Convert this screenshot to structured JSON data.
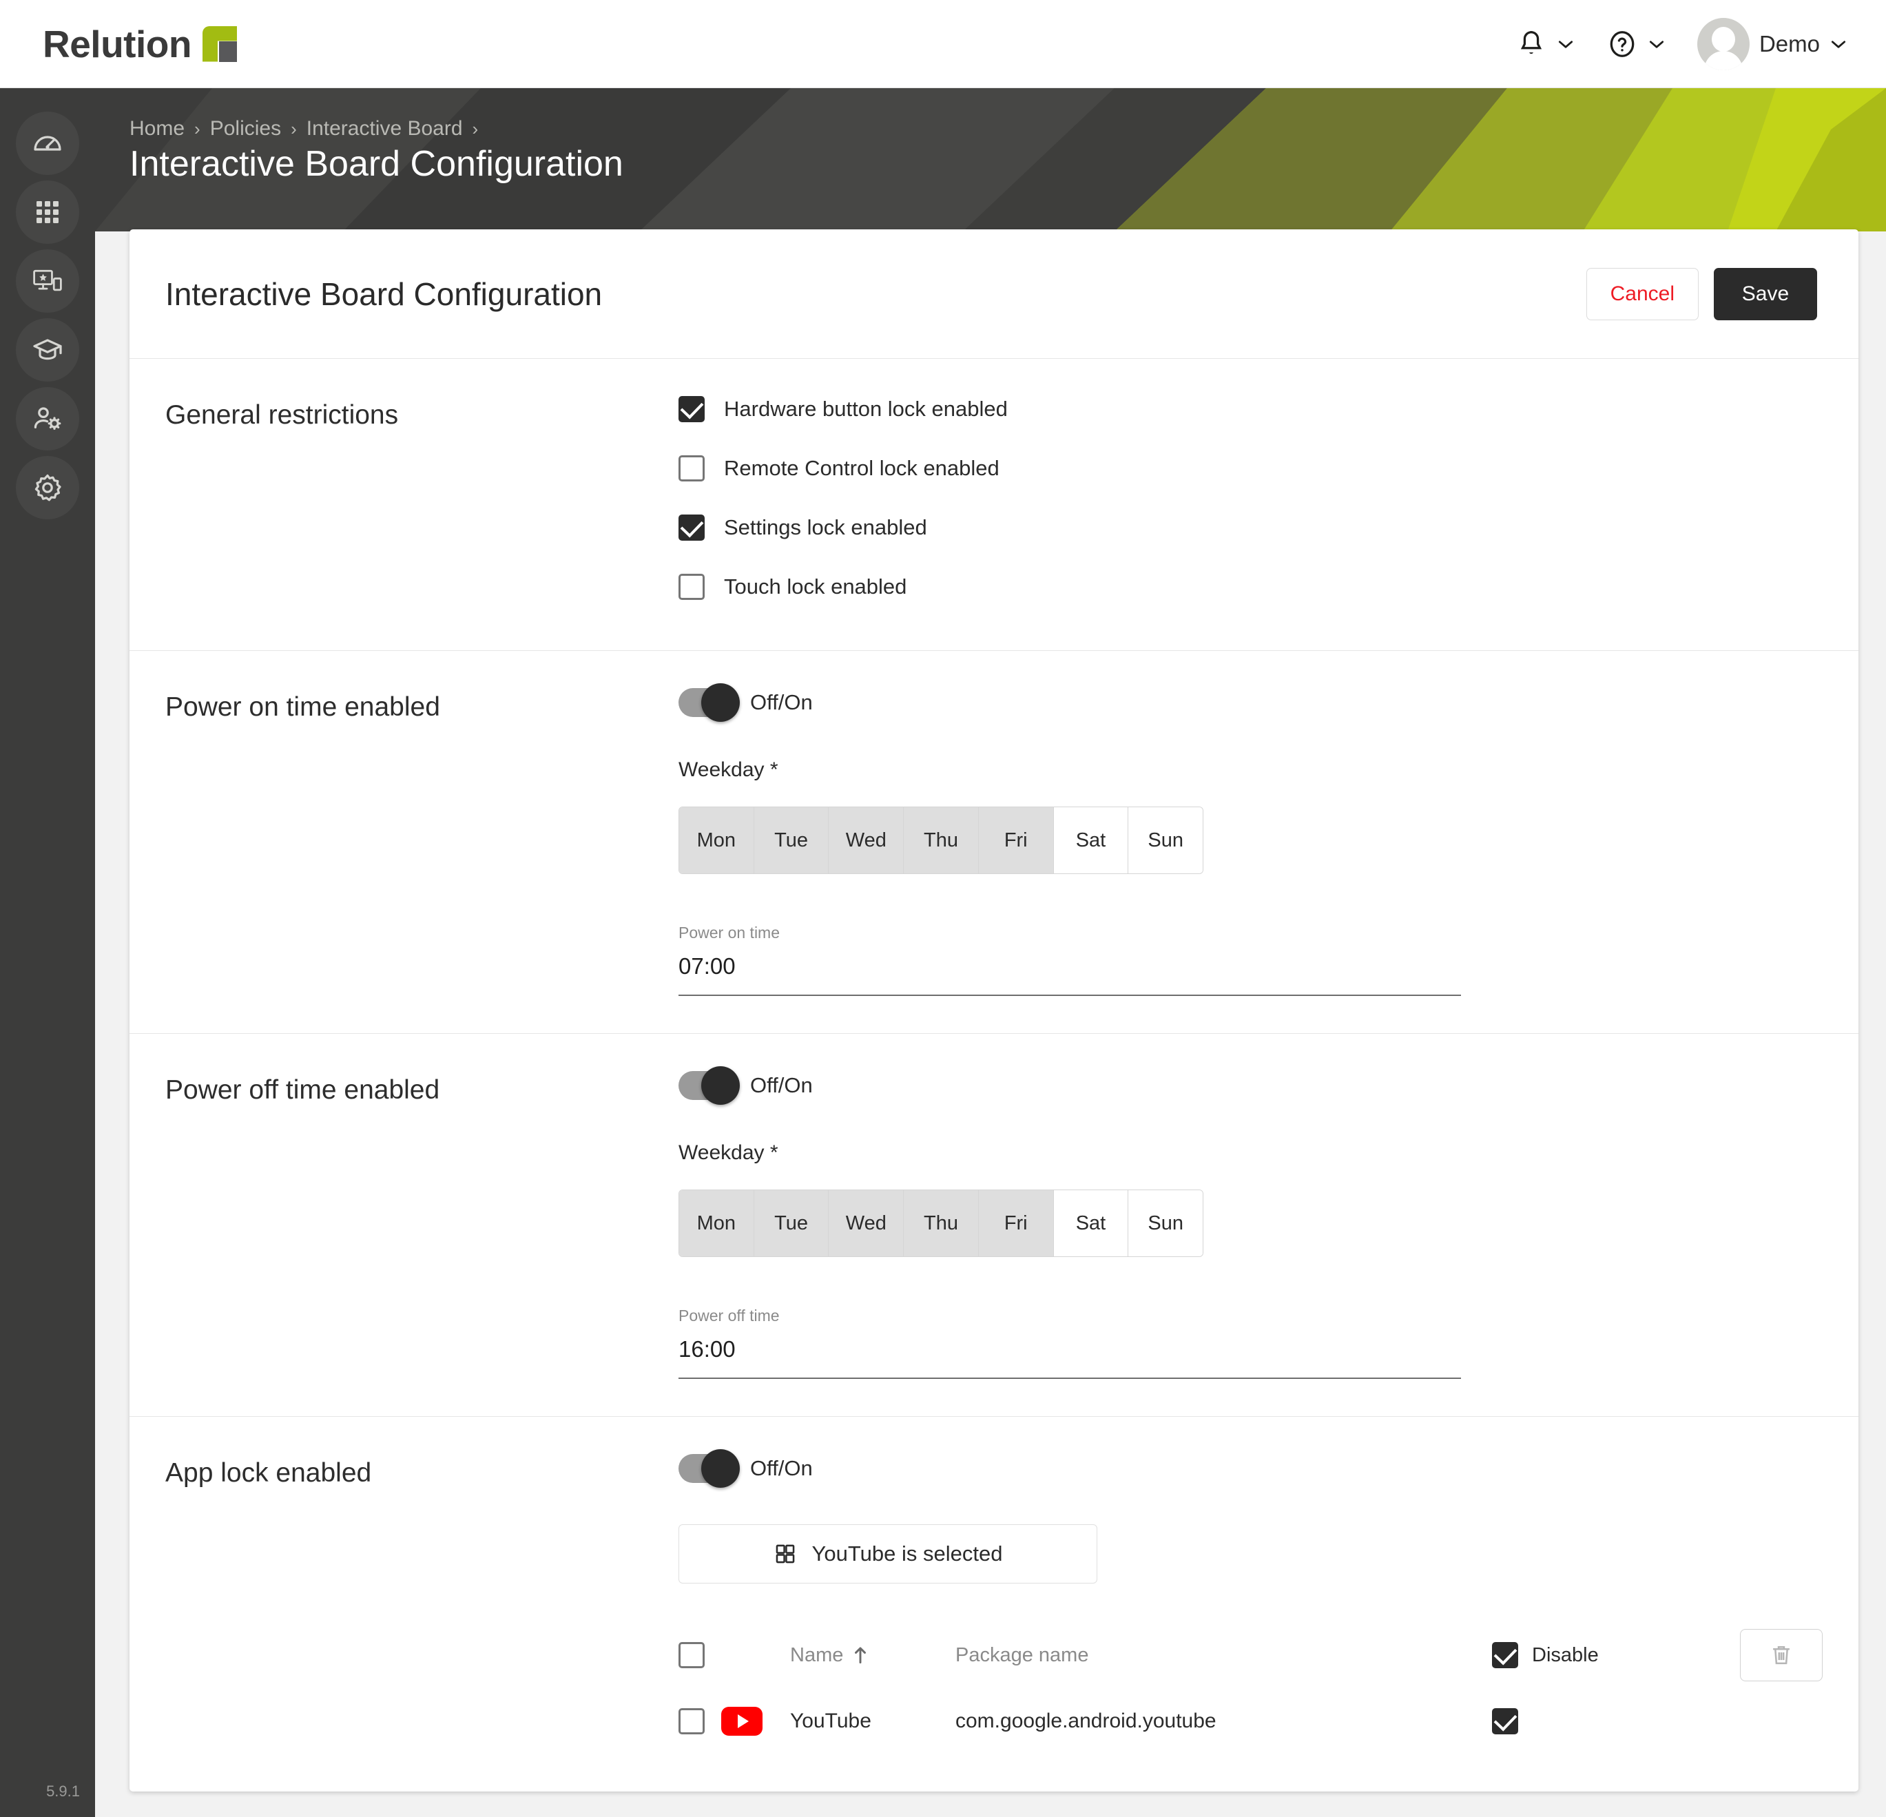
{
  "brand": {
    "name": "Relution",
    "logo_icon": "relution-logo-icon"
  },
  "topbar": {
    "notifications_icon": "bell-icon",
    "help_icon": "help-circle-icon",
    "chevron_icon": "chevron-down-icon",
    "avatar_icon": "user-avatar-icon",
    "username": "Demo"
  },
  "sidebar": {
    "items": [
      {
        "name": "dashboard",
        "icon": "speedometer-icon"
      },
      {
        "name": "apps",
        "icon": "grid-apps-icon"
      },
      {
        "name": "devices",
        "icon": "devices-star-icon"
      },
      {
        "name": "education",
        "icon": "graduation-cap-icon"
      },
      {
        "name": "users",
        "icon": "user-settings-icon"
      },
      {
        "name": "settings",
        "icon": "gear-icon"
      }
    ],
    "version": "5.9.1"
  },
  "breadcrumb": {
    "items": [
      "Home",
      "Policies",
      "Interactive Board"
    ],
    "separator": "›",
    "trailing_separator": "›"
  },
  "page": {
    "title": "Interactive Board Configuration"
  },
  "card": {
    "title": "Interactive Board Configuration",
    "cancel_label": "Cancel",
    "save_label": "Save"
  },
  "general_restrictions": {
    "label": "General restrictions",
    "checkboxes": [
      {
        "label": "Hardware button lock enabled",
        "checked": true
      },
      {
        "label": "Remote Control lock enabled",
        "checked": false
      },
      {
        "label": "Settings lock enabled",
        "checked": true
      },
      {
        "label": "Touch lock enabled",
        "checked": false
      }
    ]
  },
  "power_on": {
    "label": "Power on time enabled",
    "toggle_label": "Off/On",
    "toggle_on": true,
    "weekday_label": "Weekday *",
    "weekdays": [
      {
        "label": "Mon",
        "selected": true
      },
      {
        "label": "Tue",
        "selected": true
      },
      {
        "label": "Wed",
        "selected": true
      },
      {
        "label": "Thu",
        "selected": true
      },
      {
        "label": "Fri",
        "selected": true
      },
      {
        "label": "Sat",
        "selected": false
      },
      {
        "label": "Sun",
        "selected": false
      }
    ],
    "time_caption": "Power on time",
    "time_value": "07:00"
  },
  "power_off": {
    "label": "Power off time enabled",
    "toggle_label": "Off/On",
    "toggle_on": true,
    "weekday_label": "Weekday *",
    "weekdays": [
      {
        "label": "Mon",
        "selected": true
      },
      {
        "label": "Tue",
        "selected": true
      },
      {
        "label": "Wed",
        "selected": true
      },
      {
        "label": "Thu",
        "selected": true
      },
      {
        "label": "Fri",
        "selected": true
      },
      {
        "label": "Sat",
        "selected": false
      },
      {
        "label": "Sun",
        "selected": false
      }
    ],
    "time_caption": "Power off time",
    "time_value": "16:00"
  },
  "app_lock": {
    "label": "App lock enabled",
    "toggle_label": "Off/On",
    "toggle_on": true,
    "app_select_label": "YouTube is selected",
    "app_select_icon": "grid-apps-icon",
    "table": {
      "columns": {
        "name": "Name",
        "package": "Package name",
        "disable": "Disable"
      },
      "sort_icon": "arrow-up-icon",
      "header_select_all_checked": false,
      "header_disable_checked": true,
      "delete_icon": "trash-icon",
      "rows": [
        {
          "selected": false,
          "icon": "youtube-icon",
          "name": "YouTube",
          "package": "com.google.android.youtube",
          "disable": true
        }
      ]
    }
  },
  "colors": {
    "brand_green": "#a2bc12",
    "banner_dark": "#3c3c3b",
    "accent_red": "#ee1c25",
    "youtube_red": "#ff0000",
    "dark": "#2b2b2b"
  }
}
